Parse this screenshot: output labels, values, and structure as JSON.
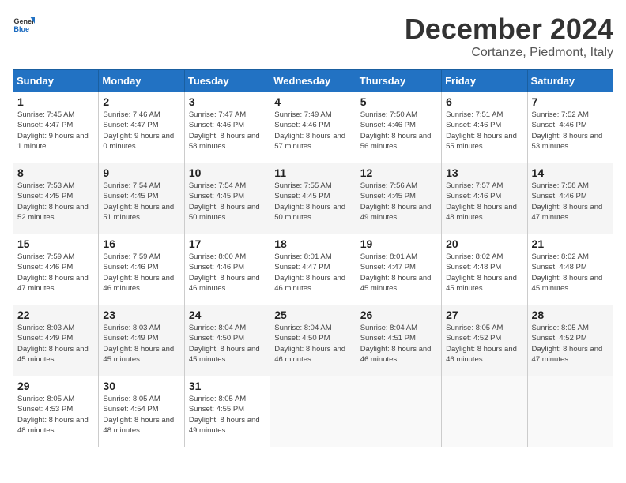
{
  "header": {
    "logo_general": "General",
    "logo_blue": "Blue",
    "month": "December 2024",
    "location": "Cortanze, Piedmont, Italy"
  },
  "weekdays": [
    "Sunday",
    "Monday",
    "Tuesday",
    "Wednesday",
    "Thursday",
    "Friday",
    "Saturday"
  ],
  "weeks": [
    [
      {
        "day": "1",
        "sunrise": "7:45 AM",
        "sunset": "4:47 PM",
        "daylight": "9 hours and 1 minute."
      },
      {
        "day": "2",
        "sunrise": "7:46 AM",
        "sunset": "4:47 PM",
        "daylight": "9 hours and 0 minutes."
      },
      {
        "day": "3",
        "sunrise": "7:47 AM",
        "sunset": "4:46 PM",
        "daylight": "8 hours and 58 minutes."
      },
      {
        "day": "4",
        "sunrise": "7:49 AM",
        "sunset": "4:46 PM",
        "daylight": "8 hours and 57 minutes."
      },
      {
        "day": "5",
        "sunrise": "7:50 AM",
        "sunset": "4:46 PM",
        "daylight": "8 hours and 56 minutes."
      },
      {
        "day": "6",
        "sunrise": "7:51 AM",
        "sunset": "4:46 PM",
        "daylight": "8 hours and 55 minutes."
      },
      {
        "day": "7",
        "sunrise": "7:52 AM",
        "sunset": "4:46 PM",
        "daylight": "8 hours and 53 minutes."
      }
    ],
    [
      {
        "day": "8",
        "sunrise": "7:53 AM",
        "sunset": "4:45 PM",
        "daylight": "8 hours and 52 minutes."
      },
      {
        "day": "9",
        "sunrise": "7:54 AM",
        "sunset": "4:45 PM",
        "daylight": "8 hours and 51 minutes."
      },
      {
        "day": "10",
        "sunrise": "7:54 AM",
        "sunset": "4:45 PM",
        "daylight": "8 hours and 50 minutes."
      },
      {
        "day": "11",
        "sunrise": "7:55 AM",
        "sunset": "4:45 PM",
        "daylight": "8 hours and 50 minutes."
      },
      {
        "day": "12",
        "sunrise": "7:56 AM",
        "sunset": "4:45 PM",
        "daylight": "8 hours and 49 minutes."
      },
      {
        "day": "13",
        "sunrise": "7:57 AM",
        "sunset": "4:46 PM",
        "daylight": "8 hours and 48 minutes."
      },
      {
        "day": "14",
        "sunrise": "7:58 AM",
        "sunset": "4:46 PM",
        "daylight": "8 hours and 47 minutes."
      }
    ],
    [
      {
        "day": "15",
        "sunrise": "7:59 AM",
        "sunset": "4:46 PM",
        "daylight": "8 hours and 47 minutes."
      },
      {
        "day": "16",
        "sunrise": "7:59 AM",
        "sunset": "4:46 PM",
        "daylight": "8 hours and 46 minutes."
      },
      {
        "day": "17",
        "sunrise": "8:00 AM",
        "sunset": "4:46 PM",
        "daylight": "8 hours and 46 minutes."
      },
      {
        "day": "18",
        "sunrise": "8:01 AM",
        "sunset": "4:47 PM",
        "daylight": "8 hours and 46 minutes."
      },
      {
        "day": "19",
        "sunrise": "8:01 AM",
        "sunset": "4:47 PM",
        "daylight": "8 hours and 45 minutes."
      },
      {
        "day": "20",
        "sunrise": "8:02 AM",
        "sunset": "4:48 PM",
        "daylight": "8 hours and 45 minutes."
      },
      {
        "day": "21",
        "sunrise": "8:02 AM",
        "sunset": "4:48 PM",
        "daylight": "8 hours and 45 minutes."
      }
    ],
    [
      {
        "day": "22",
        "sunrise": "8:03 AM",
        "sunset": "4:49 PM",
        "daylight": "8 hours and 45 minutes."
      },
      {
        "day": "23",
        "sunrise": "8:03 AM",
        "sunset": "4:49 PM",
        "daylight": "8 hours and 45 minutes."
      },
      {
        "day": "24",
        "sunrise": "8:04 AM",
        "sunset": "4:50 PM",
        "daylight": "8 hours and 45 minutes."
      },
      {
        "day": "25",
        "sunrise": "8:04 AM",
        "sunset": "4:50 PM",
        "daylight": "8 hours and 46 minutes."
      },
      {
        "day": "26",
        "sunrise": "8:04 AM",
        "sunset": "4:51 PM",
        "daylight": "8 hours and 46 minutes."
      },
      {
        "day": "27",
        "sunrise": "8:05 AM",
        "sunset": "4:52 PM",
        "daylight": "8 hours and 46 minutes."
      },
      {
        "day": "28",
        "sunrise": "8:05 AM",
        "sunset": "4:52 PM",
        "daylight": "8 hours and 47 minutes."
      }
    ],
    [
      {
        "day": "29",
        "sunrise": "8:05 AM",
        "sunset": "4:53 PM",
        "daylight": "8 hours and 48 minutes."
      },
      {
        "day": "30",
        "sunrise": "8:05 AM",
        "sunset": "4:54 PM",
        "daylight": "8 hours and 48 minutes."
      },
      {
        "day": "31",
        "sunrise": "8:05 AM",
        "sunset": "4:55 PM",
        "daylight": "8 hours and 49 minutes."
      },
      null,
      null,
      null,
      null
    ]
  ]
}
